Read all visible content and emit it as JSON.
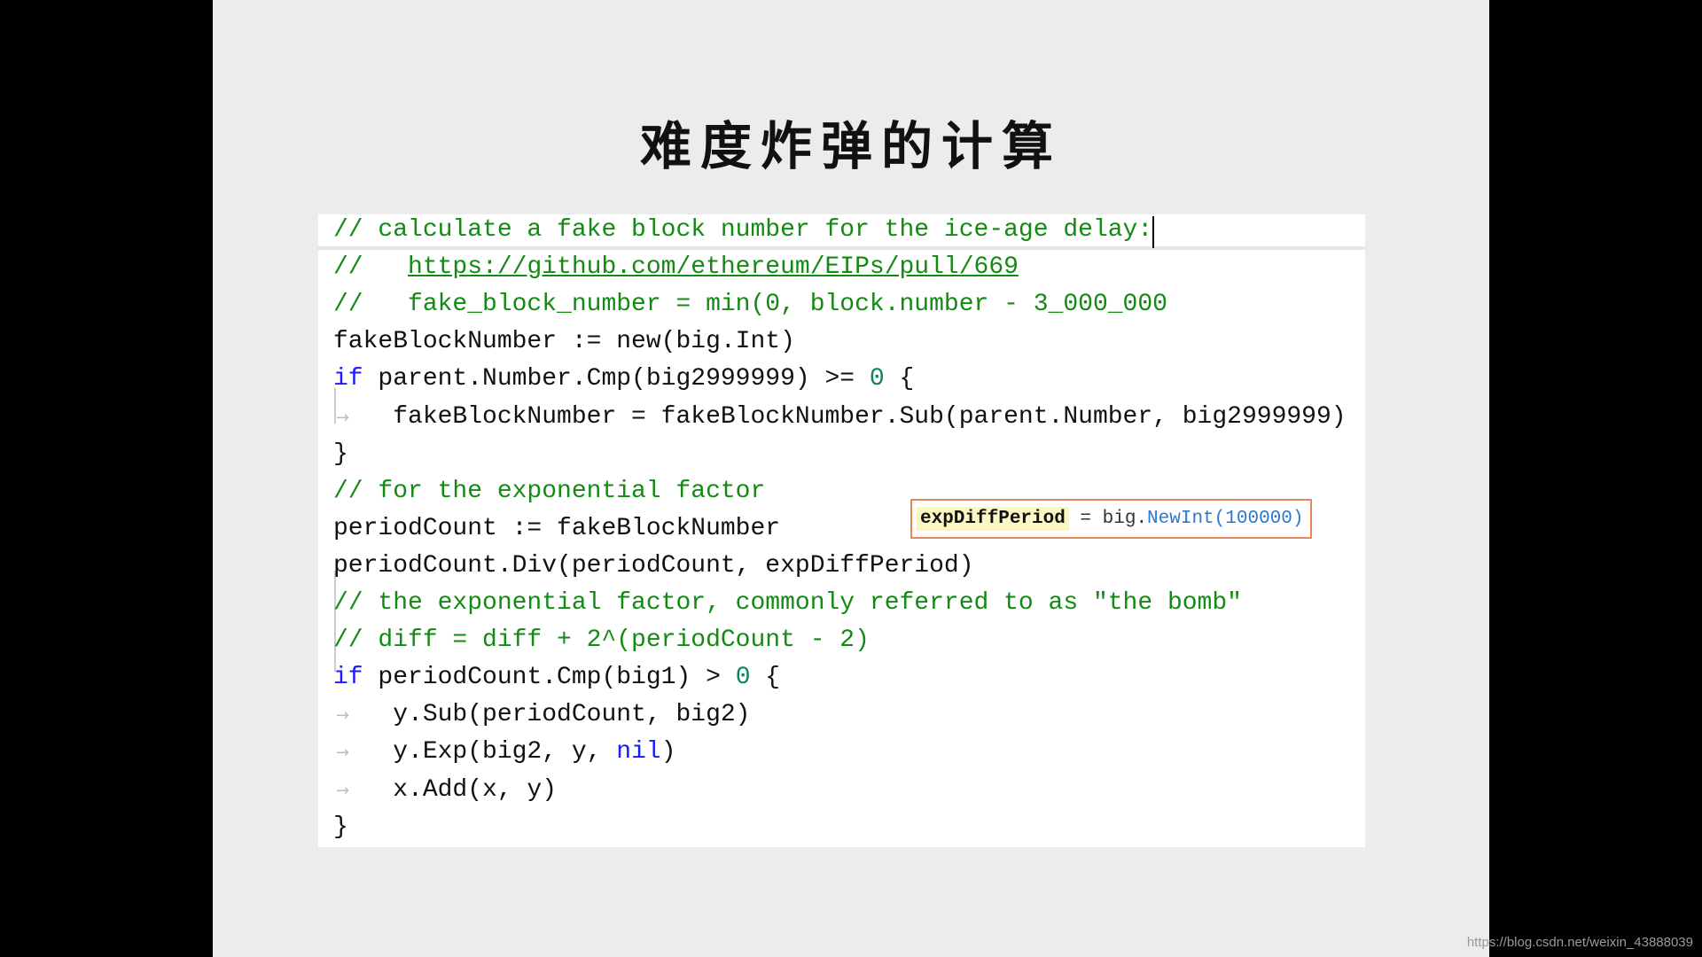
{
  "slide": {
    "title": "难度炸弹的计算",
    "code_lines": [
      [
        {
          "t": "// calculate a fake block number for the ice-age delay:",
          "c": "c"
        }
      ],
      [
        {
          "t": "//   ",
          "c": "c"
        },
        {
          "t": "https://github.com/ethereum/EIPs/pull/669",
          "c": "c u"
        }
      ],
      [
        {
          "t": "//   fake_block_number = min(0, block.number - 3_000_000",
          "c": "c"
        }
      ],
      [
        {
          "t": "fakeBlockNumber := new(big.Int)",
          "c": ""
        }
      ],
      [
        {
          "t": "if",
          "c": "k"
        },
        {
          "t": " parent.Number.Cmp(big2999999) >= ",
          "c": ""
        },
        {
          "t": "0",
          "c": "n"
        },
        {
          "t": " {",
          "c": ""
        }
      ],
      [
        {
          "t": "    fakeBlockNumber = fakeBlockNumber.Sub(parent.Number, big2999999)",
          "c": ""
        }
      ],
      [
        {
          "t": "}",
          "c": ""
        }
      ],
      [
        {
          "t": "// for the exponential factor",
          "c": "c"
        }
      ],
      [
        {
          "t": "periodCount := fakeBlockNumber",
          "c": ""
        }
      ],
      [
        {
          "t": "periodCount.Div(periodCount, expDiffPeriod)",
          "c": ""
        }
      ],
      [
        {
          "t": "// the exponential factor, commonly referred to as \"the bomb\"",
          "c": "c"
        }
      ],
      [
        {
          "t": "// diff = diff + 2^(periodCount - 2)",
          "c": "c"
        }
      ],
      [
        {
          "t": "if",
          "c": "k"
        },
        {
          "t": " periodCount.Cmp(big1) > ",
          "c": ""
        },
        {
          "t": "0",
          "c": "n"
        },
        {
          "t": " {",
          "c": ""
        }
      ],
      [
        {
          "t": "    y.Sub(periodCount, big2)",
          "c": ""
        }
      ],
      [
        {
          "t": "    y.Exp(big2, y, ",
          "c": ""
        },
        {
          "t": "nil",
          "c": "k"
        },
        {
          "t": ")",
          "c": ""
        }
      ],
      [
        {
          "t": "    x.Add(x, y)",
          "c": ""
        }
      ],
      [
        {
          "t": "}",
          "c": ""
        }
      ]
    ],
    "tooltip": {
      "name": "expDiffPeriod",
      "eq": " = big.",
      "fn": "NewInt(100000)"
    }
  },
  "watermark": "https://blog.csdn.net/weixin_43888039",
  "colors": {
    "comment": "#138a13",
    "keyword": "#1a1aff",
    "number": "#098658",
    "tooltip_border": "#e8875a"
  }
}
